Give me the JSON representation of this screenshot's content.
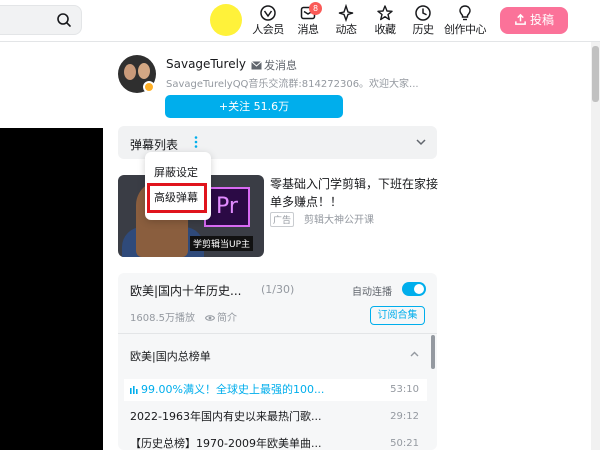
{
  "header": {
    "nav": [
      {
        "label": "人会员",
        "icon": "vip-icon"
      },
      {
        "label": "消息",
        "icon": "message-icon",
        "badge": "8"
      },
      {
        "label": "动态",
        "icon": "dynamic-icon"
      },
      {
        "label": "收藏",
        "icon": "star-icon"
      },
      {
        "label": "历史",
        "icon": "clock-icon"
      },
      {
        "label": "创作中心",
        "icon": "bulb-icon"
      }
    ],
    "upload_label": "投稿"
  },
  "uploader": {
    "name": "SavageTurely",
    "message_label": "发消息",
    "desc": "SavageTurelyQQ音乐交流群:814272306。欢迎大家...",
    "follow_label": "+关注 51.6万"
  },
  "danmaku": {
    "title": "弹幕列表",
    "menu": [
      "屏蔽设定",
      "高级弹幕"
    ]
  },
  "ad": {
    "title": "零基础入门学剪辑，下班在家接单多赚点！！",
    "tag": "广告",
    "source": "剪辑大神公开课",
    "thumb_caption": "学剪辑当UP主",
    "thumb_logo": "Pr"
  },
  "playlist": {
    "title": "欧美|国内十年历史...",
    "count": "(1/30)",
    "autoplay_label": "自动连播",
    "plays": "1608.5万播放",
    "intro_label": "简介",
    "subscribe_label": "订阅合集",
    "section_title": "欧美|国内总榜单",
    "episodes": [
      {
        "title": "99.00%满义！全球史上最强的100...",
        "duration": "53:10",
        "active": true
      },
      {
        "title": "2022-1963年国内有史以来最热门歌...",
        "duration": "29:12",
        "active": false
      },
      {
        "title": "【历史总榜】1970-2009年欧美单曲...",
        "duration": "50:21",
        "active": false
      }
    ]
  },
  "colors": {
    "accent": "#00aeec",
    "upload": "#fb7299",
    "highlight": "#e0141c",
    "avatar_placeholder": "#fff23a"
  }
}
